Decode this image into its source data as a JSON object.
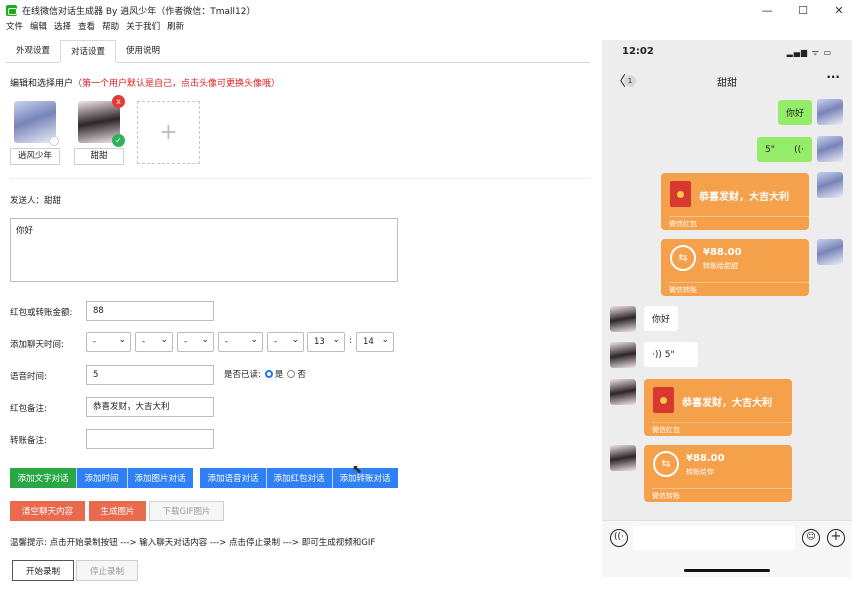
{
  "window": {
    "title": "在线微信对话生成器 By 逍风少年（作者微信：Tmall12）"
  },
  "menu": [
    "文件",
    "编辑",
    "选择",
    "查看",
    "帮助",
    "关于我们",
    "刷新"
  ],
  "tabs": [
    "外观设置",
    "对话设置",
    "使用说明"
  ],
  "users_section": {
    "title": "编辑和选择用户",
    "hint": "（第一个用户默认是自己，点击头像可更换头像哦）"
  },
  "users": [
    {
      "name": "逍风少年"
    },
    {
      "name": "甜甜"
    }
  ],
  "add_user_glyph": "+",
  "sender": {
    "label": "发送人：",
    "name": "甜甜"
  },
  "message": {
    "value": "你好"
  },
  "form": {
    "amount_label": "红包或转账金额:",
    "amount_value": "88",
    "time_label": "添加聊天时间:",
    "time_selects": [
      "-",
      "-",
      "-",
      "-",
      "-",
      "13",
      "14"
    ],
    "time_colon": ":",
    "voice_label": "语音时间:",
    "voice_value": "5",
    "read_label": "是否已读:",
    "read_yes": "是",
    "read_no": "否",
    "redpacket_note_label": "红包备注:",
    "redpacket_note_value": "恭喜发财，大吉大利",
    "transfer_note_label": "转账备注:",
    "transfer_note_value": ""
  },
  "buttons": {
    "add_text": "添加文字对话",
    "add_time": "添加时间",
    "add_image": "添加图片对话",
    "add_voice": "添加语音对话",
    "add_redpacket": "添加红包对话",
    "add_transfer": "添加转账对话",
    "clear_chat": "清空聊天内容",
    "gen_image": "生成图片",
    "download_gif": "下载GIF图片",
    "start_record": "开始录制",
    "stop_record": "停止录制"
  },
  "tip": "温馨提示: 点击开始录制按钮 ---> 输入聊天对话内容 ---> 点击停止录制 ---> 即可生成视频和GIF",
  "phone": {
    "time": "12:02",
    "signal": "▂▄▆ ᯤ ▭",
    "back_glyph": "〈",
    "back_count": "1",
    "contact": "甜甜",
    "more": "···",
    "voice_glyph_out": "((·",
    "voice_glyph_in": "·))",
    "transfer_glyph": "⇆",
    "chat": {
      "out_text": "你好",
      "out_voice": "5\"",
      "out_redpacket": "恭喜发财，大吉大利",
      "out_redpacket_foot": "微信红包",
      "out_transfer_amount": "¥88.00",
      "out_transfer_note": "转账给甜甜",
      "out_transfer_foot": "微信转账",
      "in_text": "你好",
      "in_voice": "5\"",
      "in_redpacket": "恭喜发财，大吉大利",
      "in_redpacket_foot": "微信红包",
      "in_transfer_amount": "¥88.00",
      "in_transfer_note": "转账给你",
      "in_transfer_foot": "微信转账"
    },
    "input_icons": {
      "voice": "((·",
      "emoji": "☺",
      "plus": "+"
    }
  }
}
